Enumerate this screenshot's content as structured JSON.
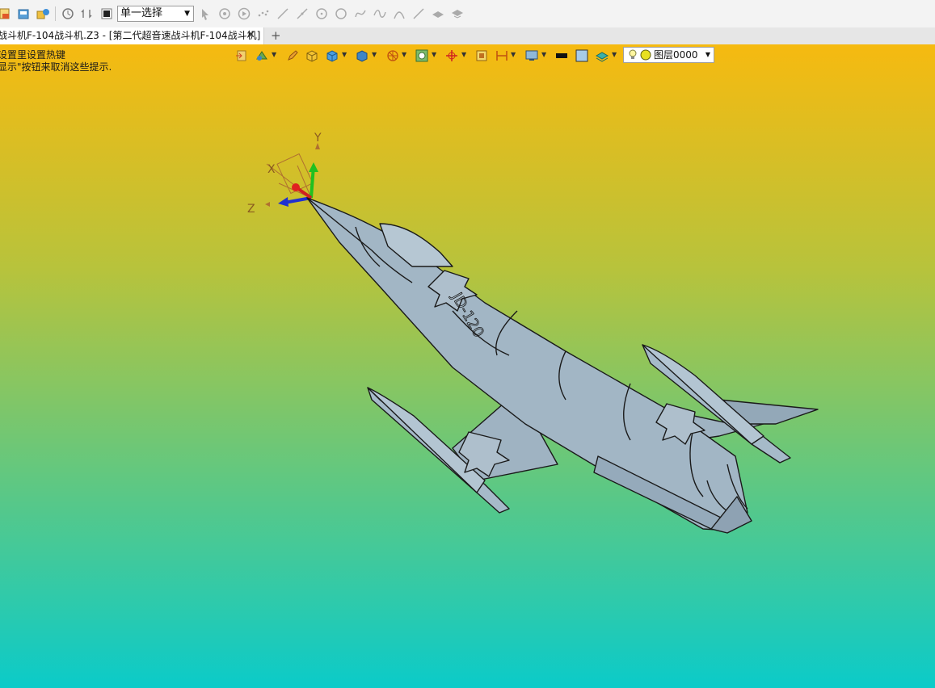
{
  "toolbar": {
    "selection_mode": "单一选择",
    "icons": [
      "new-file-icon",
      "open-file-icon",
      "import-icon",
      "history-icon",
      "undo-redo-icon",
      "stop-icon",
      "select-cursor-icon",
      "filter-icon",
      "play-icon",
      "points-icon",
      "line-icon",
      "line2-icon",
      "circle-center-icon",
      "circle-icon",
      "curve-icon",
      "spline-icon",
      "arc-icon",
      "line3-icon",
      "surface-icon",
      "mesh-icon"
    ]
  },
  "tabs": {
    "active_title": "战斗机F-104战斗机.Z3 - [第二代超音速战斗机F-104战斗机]",
    "close_glyph": "✕",
    "new_tab_glyph": "+"
  },
  "viewport": {
    "hint_line1": "设置里设置热键",
    "hint_line2": "显示\"按钮来取消这些提示.",
    "layer_label": "图层0000",
    "gradient_colors": [
      "#f6ba10",
      "#b7c33c",
      "#5fc882",
      "#0bcbc9"
    ],
    "axis_labels": {
      "x": "X",
      "y": "Y",
      "z": "Z"
    },
    "model_marking": "JD-120"
  }
}
